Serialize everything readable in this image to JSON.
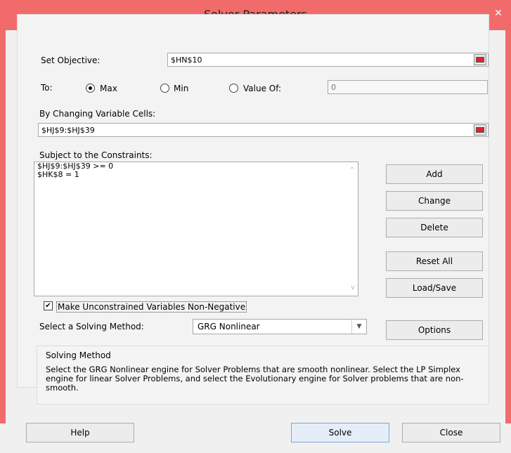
{
  "window": {
    "title": "Solver Parameters",
    "close_glyph": "✕"
  },
  "objective": {
    "label": "Set Objective:",
    "value": "$HN$10"
  },
  "to": {
    "label": "To:",
    "options": [
      {
        "label": "Max",
        "selected": true
      },
      {
        "label": "Min",
        "selected": false
      },
      {
        "label": "Value Of:",
        "selected": false
      }
    ],
    "value_of": "0"
  },
  "changing": {
    "label": "By Changing Variable Cells:",
    "value": "$HJ$9:$HJ$39"
  },
  "constraints": {
    "label": "Subject to the Constraints:",
    "items": [
      "$HJ$9:$HJ$39 >= 0",
      "$HK$8 = 1"
    ]
  },
  "buttons": {
    "add": "Add",
    "change": "Change",
    "delete": "Delete",
    "reset_all": "Reset All",
    "load_save": "Load/Save",
    "options": "Options",
    "help": "Help",
    "solve": "Solve",
    "close": "Close"
  },
  "nonneg": {
    "label": "Make Unconstrained Variables Non-Negative",
    "checked": true,
    "check_glyph": "✔"
  },
  "method": {
    "label": "Select a Solving Method:",
    "value": "GRG Nonlinear",
    "arrow_glyph": "▼"
  },
  "method_box": {
    "title": "Solving Method",
    "description": "Select the GRG Nonlinear engine for Solver Problems that are smooth nonlinear. Select the LP Simplex engine for linear Solver Problems, and select the Evolutionary engine for Solver problems that are non-smooth."
  },
  "colors": {
    "titlebar": "#f26b6b",
    "background": "#f0f0f0"
  }
}
